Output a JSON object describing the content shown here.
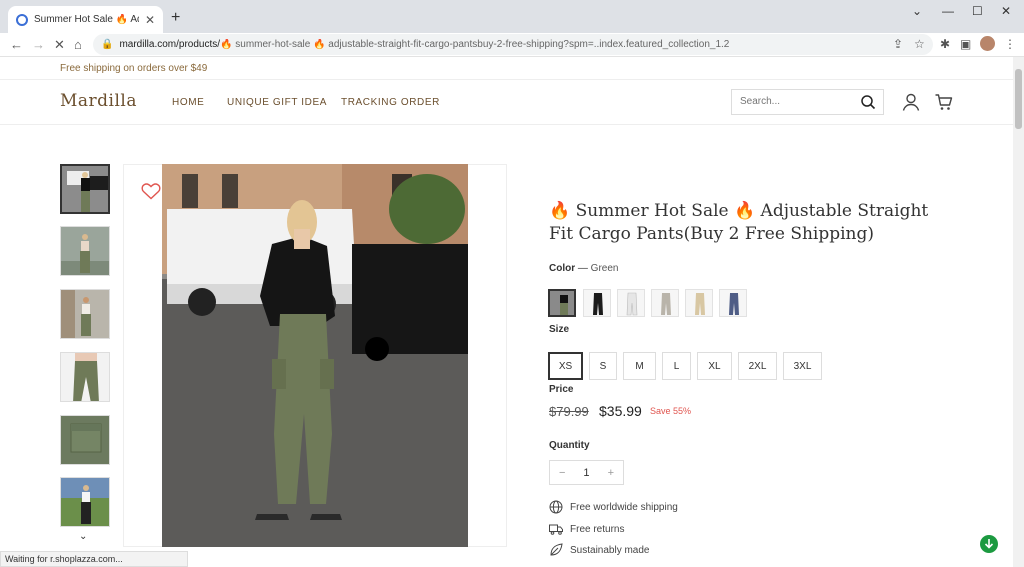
{
  "browser": {
    "tab_title": "Summer Hot Sale 🔥 Adjustab",
    "url_host": "mardilla.com/products/",
    "url_path": "🔥 summer-hot-sale 🔥 adjustable-straight-fit-cargo-pantsbuy-2-free-shipping?spm=..index.featured_collection_1.2",
    "status_text": "Waiting for r.shoplazza.com..."
  },
  "site": {
    "announcement": "Free shipping on orders over $49",
    "logo": "Mardilla",
    "nav": [
      "HOME",
      "UNIQUE GIFT IDEA",
      "TRACKING ORDER"
    ],
    "search_placeholder": "Search..."
  },
  "product": {
    "title_line1": "🔥 Summer Hot Sale 🔥 Adjustable Straight",
    "title_line2": "Fit Cargo Pants(Buy 2 Free Shipping)",
    "color_label": "Color",
    "color_dash": "—",
    "color_value": "Green",
    "size_label": "Size",
    "sizes": [
      "XS",
      "S",
      "M",
      "L",
      "XL",
      "2XL",
      "3XL"
    ],
    "price_label": "Price",
    "old_price": "$79.99",
    "new_price": "$35.99",
    "save": "Save 55%",
    "quantity_label": "Quantity",
    "quantity": "1",
    "qty_minus": "−",
    "qty_plus": "+",
    "features": [
      "Free worldwide shipping",
      "Free returns",
      "Sustainably made"
    ]
  },
  "colors": {
    "brand": "#6b4f2e",
    "sale": "#e0554f",
    "pants_green": "#6f7a58"
  }
}
